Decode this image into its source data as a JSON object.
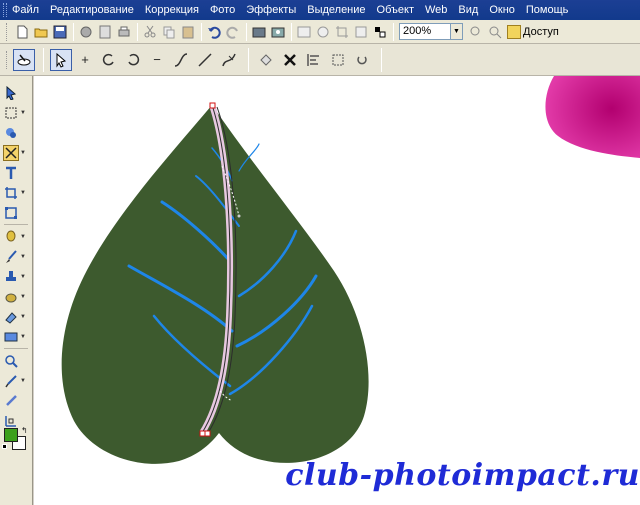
{
  "menu": {
    "items": [
      {
        "label": "Файл"
      },
      {
        "label": "Редактирование"
      },
      {
        "label": "Коррекция"
      },
      {
        "label": "Фото"
      },
      {
        "label": "Эффекты"
      },
      {
        "label": "Выделение"
      },
      {
        "label": "Объект"
      },
      {
        "label": "Web"
      },
      {
        "label": "Вид"
      },
      {
        "label": "Окно"
      },
      {
        "label": "Помощь"
      }
    ]
  },
  "toolbar": {
    "zoom_value": "200%",
    "access_label": "Доступ"
  },
  "canvas": {
    "watermark": "club-photoimpact.ru"
  },
  "colors": {
    "leaf": "#3d5a2e",
    "vein": "#1e86e8",
    "foreground_swatch": "#3ca01c",
    "background_swatch": "#ffffff",
    "pink_shape": "#cc1a8a",
    "watermark": "#1f2bd6"
  }
}
